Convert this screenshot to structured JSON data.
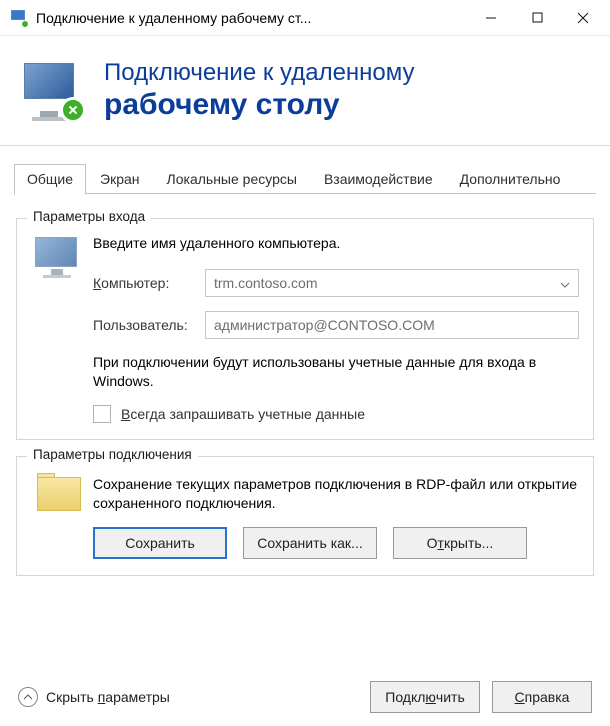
{
  "window": {
    "title": "Подключение к удаленному рабочему ст..."
  },
  "header": {
    "line1": "Подключение к удаленному",
    "line2": "рабочему столу"
  },
  "tabs": [
    {
      "label": "Общие",
      "active": true
    },
    {
      "label": "Экран",
      "active": false
    },
    {
      "label": "Локальные ресурсы",
      "active": false
    },
    {
      "label": "Взаимодействие",
      "active": false
    },
    {
      "label": "Дополнительно",
      "active": false
    }
  ],
  "login_group": {
    "title": "Параметры входа",
    "instruction": "Введите имя удаленного компьютера.",
    "computer_label": "Компьютер:",
    "computer_value": "trm.contoso.com",
    "user_label": "Пользователь:",
    "user_value": "администратор@CONTOSO.COM",
    "hint": "При подключении будут использованы учетные данные для входа в Windows.",
    "checkbox_label": "Всегда запрашивать учетные данные"
  },
  "conn_group": {
    "title": "Параметры подключения",
    "description": "Сохранение текущих параметров подключения в RDP-файл или открытие сохраненного подключения.",
    "save_label": "Сохранить",
    "save_as_label": "Сохранить как...",
    "open_label": "Открыть..."
  },
  "bottom": {
    "collapse_label": "Скрыть параметры",
    "connect_label": "Подключить",
    "help_label": "Справка"
  }
}
